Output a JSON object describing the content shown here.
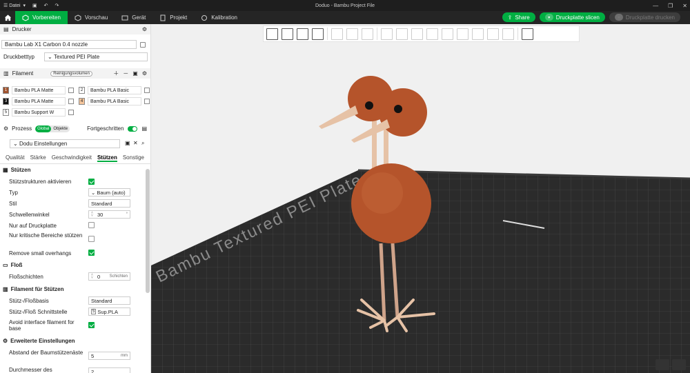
{
  "titlebar": {
    "menu_label": "Datei",
    "title": "Doduo - Bambu Project File"
  },
  "tabs": [
    {
      "label": "Vorbereiten",
      "active": true,
      "icon": "cube-icon"
    },
    {
      "label": "Vorschau",
      "active": false,
      "icon": "eye-icon"
    },
    {
      "label": "Gerät",
      "active": false,
      "icon": "monitor-icon"
    },
    {
      "label": "Projekt",
      "active": false,
      "icon": "document-icon"
    },
    {
      "label": "Kalibration",
      "active": false,
      "icon": "calibrate-icon"
    }
  ],
  "actions": {
    "share": "Share",
    "slice": "Druckplatte slicen",
    "print": "Druckplatte drucken"
  },
  "printer": {
    "section": "Drucker",
    "name": "Bambu Lab X1 Carbon 0.4 nozzle",
    "bed_label": "Druckbetttyp",
    "bed_value": "Textured PEI Plate"
  },
  "filament": {
    "section": "Filament",
    "purge_label": "Reinigungsvolumen",
    "items": [
      {
        "num": "1",
        "name": "Bambu PLA Matte",
        "color": "#a0522d"
      },
      {
        "num": "2",
        "name": "Bambu PLA Basic",
        "color": "#ffffff"
      },
      {
        "num": "3",
        "name": "Bambu PLA Matte",
        "color": "#111111"
      },
      {
        "num": "4",
        "name": "Bambu PLA Basic",
        "color": "#f2c49b"
      },
      {
        "num": "5",
        "name": "Bambu Support W",
        "color": "#ffffff"
      }
    ]
  },
  "process": {
    "section": "Prozess",
    "global": "Global",
    "objects": "Objekte",
    "advanced": "Fortgeschritten",
    "preset": "Dodu Einstellungen"
  },
  "subtabs": [
    "Qualität",
    "Stärke",
    "Geschwindigkeit",
    "Stützen",
    "Sonstige"
  ],
  "support": {
    "section": "Stützen",
    "enable": "Stützstrukturen aktivieren",
    "type_label": "Typ",
    "type_value": "Baum (auto)",
    "style_label": "Stil",
    "style_value": "Standard",
    "threshold_label": "Schwellenwinkel",
    "threshold_value": "30",
    "build_plate_only": "Nur auf Druckplatte",
    "critical_only": "Nur kritische Bereiche stützen",
    "remove_small": "Remove small overhangs"
  },
  "raft": {
    "section": "Floß",
    "layers_label": "Floßschichten",
    "layers_value": "0",
    "layers_unit": "Schichten"
  },
  "support_filament": {
    "section": "Filament für Stützen",
    "base_label": "Stütz-/Floßbasis",
    "base_value": "Standard",
    "interface_label": "Stütz-/Floß Schnittstelle",
    "interface_num": "5",
    "interface_value": "Sup.PLA",
    "avoid_label": "Avoid interface filament for base"
  },
  "advanced": {
    "section": "Erweiterte Einstellungen",
    "branch_dist_label": "Abstand der Baumstützenäste",
    "branch_dist_value": "5",
    "branch_dist_unit": "mm",
    "diameter_label": "Durchmesser des",
    "diameter_value": "2"
  },
  "plate_text": "Bambu Textured PEI Plate",
  "colors": {
    "accent": "#00ae42",
    "body": "#b5542b",
    "neck": "#e6c2a6",
    "plate": "#2b2b2b"
  }
}
